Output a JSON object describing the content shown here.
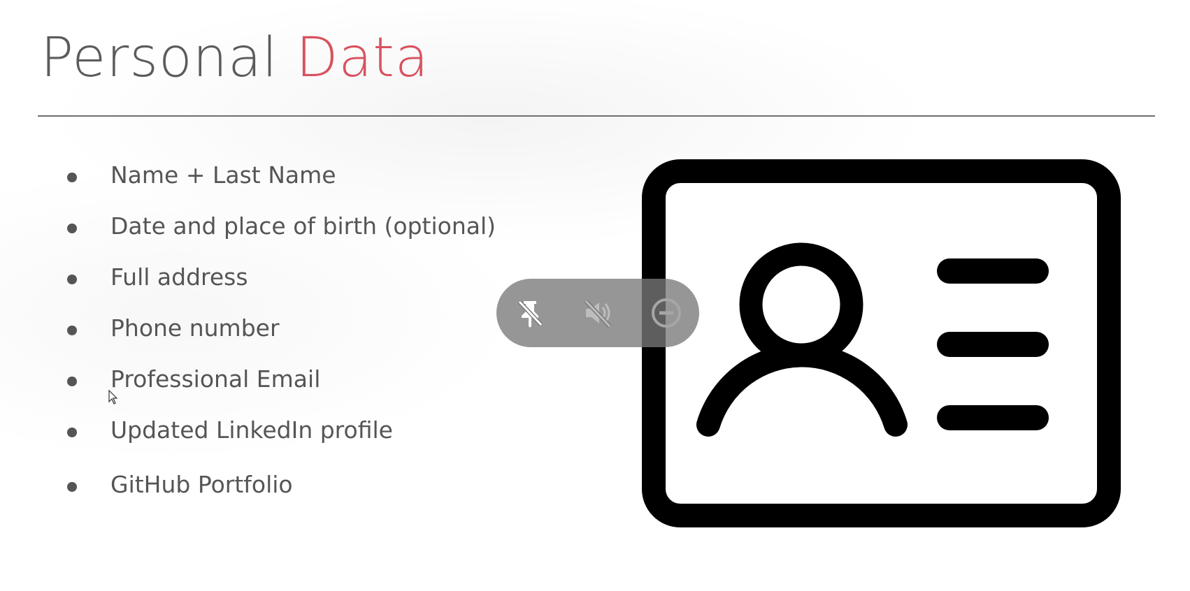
{
  "slide": {
    "title_main": "Personal",
    "title_accent": "Data",
    "accent_color": "#d8525f",
    "text_color": "#555555",
    "bullets": [
      "Name + Last Name",
      "Date and place of birth (optional)",
      "Full address",
      "Phone number",
      "Professional Email",
      "Updated LinkedIn profile",
      "GitHub Portfolio"
    ],
    "illustration_icon": "id-card-icon"
  },
  "media_controls": {
    "pin_icon": "pin-off-icon",
    "mute_icon": "volume-off-icon",
    "minimize_icon": "minus-circle-icon"
  },
  "cursor_icon": "mouse-pointer-icon"
}
